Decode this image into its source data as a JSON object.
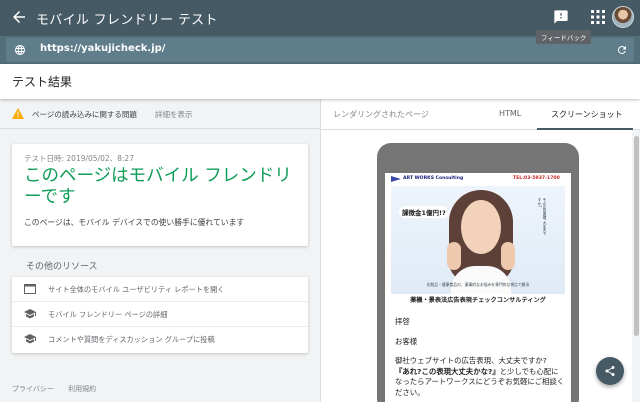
{
  "topbar": {
    "title": "モバイル フレンドリー テスト",
    "feedback_tooltip": "フィードバック"
  },
  "urlbar": {
    "url": "https://yakujicheck.jp/"
  },
  "results": {
    "heading": "テスト結果"
  },
  "issue": {
    "text": "ページの読み込みに関する問題",
    "link": "詳細を表示"
  },
  "verdict": {
    "date": "テスト日時: 2019/05/02、8:27",
    "headline": "このページはモバイル フレンドリーです",
    "detail": "このページは、モバイル デバイスでの使い勝手に優れています"
  },
  "other_resources": {
    "heading": "その他のリソース",
    "items": [
      {
        "label": "サイト全体のモバイル ユーザビリティ レポートを開く",
        "icon": "browser-window-icon"
      },
      {
        "label": "モバイル フレンドリー ページの詳細",
        "icon": "graduation-cap-icon"
      },
      {
        "label": "コメントや質問をディスカッション グループに投稿",
        "icon": "graduation-cap-icon"
      }
    ]
  },
  "footer": {
    "privacy": "プライバシー",
    "terms": "利用規約"
  },
  "preview": {
    "rendered_label": "レンダリングされたページ",
    "tabs": [
      "HTML",
      "スクリーンショット"
    ],
    "active_tab": "スクリーンショット"
  },
  "site": {
    "brand": "ART WORKS Consulting",
    "tel": "TEL:03-5937-1700",
    "badge": "課徴金1億円!?",
    "side_text": "その広告表現 大丈夫ですか?",
    "caption": "化粧品・健康食品の、薬事的なお悩みを専門的な視点で解決",
    "service_title": "薬機・景表法広告表現チェックコンサルティング",
    "greeting": "拝啓",
    "salutation": "お客様",
    "paragraph_start": "御社ウェブサイトの広告表現、大丈夫ですか?",
    "paragraph_bold": "『あれ?この表現大丈夫かな?』",
    "paragraph_end": "と少しでも心配になったらアートワークスにどうぞお気軽にご相談ください。"
  },
  "colors": {
    "header": "#455a64",
    "urlbar": "#546e7a",
    "success": "#0f9d58",
    "warning": "#f9ab00"
  }
}
